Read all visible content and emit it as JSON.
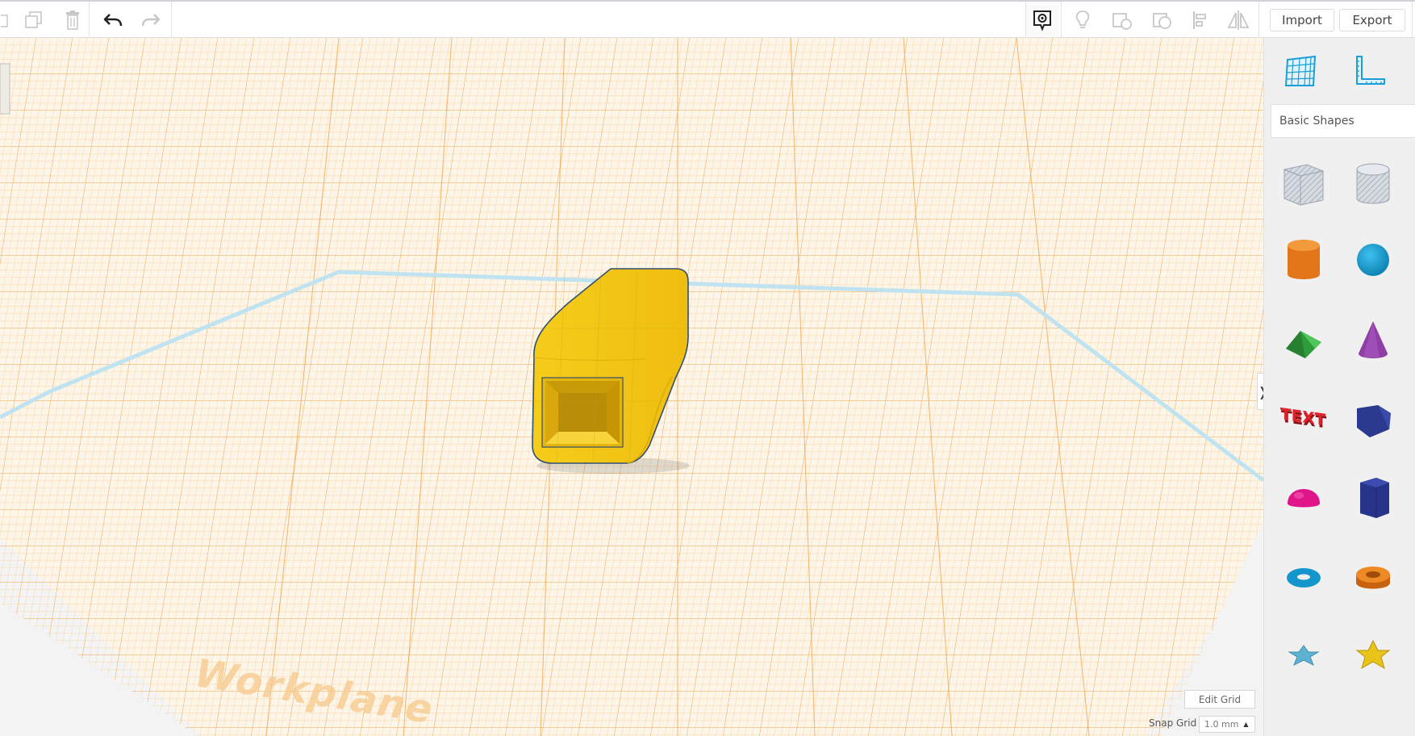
{
  "toolbar": {
    "import_label": "Import",
    "export_label": "Export",
    "icons": [
      "copy-icon",
      "duplicate-icon",
      "trash-icon",
      "undo-icon",
      "redo-icon",
      "notes-icon",
      "lightbulb-icon",
      "shape-icon",
      "hole-icon",
      "align-icon",
      "mirror-icon"
    ]
  },
  "viewport": {
    "workplane_label": "Workplane",
    "edit_grid_label": "Edit Grid",
    "snap_grid_label": "Snap Grid",
    "snap_grid_value": "1.0 mm",
    "collapse_glyph": "❭"
  },
  "sidebar": {
    "category_label": "Basic Shapes",
    "tools": [
      "workplane-tool",
      "ruler-tool"
    ],
    "shapes": [
      "box-hole",
      "cylinder-hole",
      "cylinder",
      "sphere",
      "roof",
      "cone",
      "text",
      "wedge",
      "half-sphere",
      "polygon",
      "torus",
      "tube",
      "star-light-blue",
      "star-yellow"
    ],
    "text_shape_label": "TEXT"
  },
  "colors": {
    "grid": "#f0a340",
    "object": "#f2c817",
    "accent_blue": "#1a9ed8"
  }
}
